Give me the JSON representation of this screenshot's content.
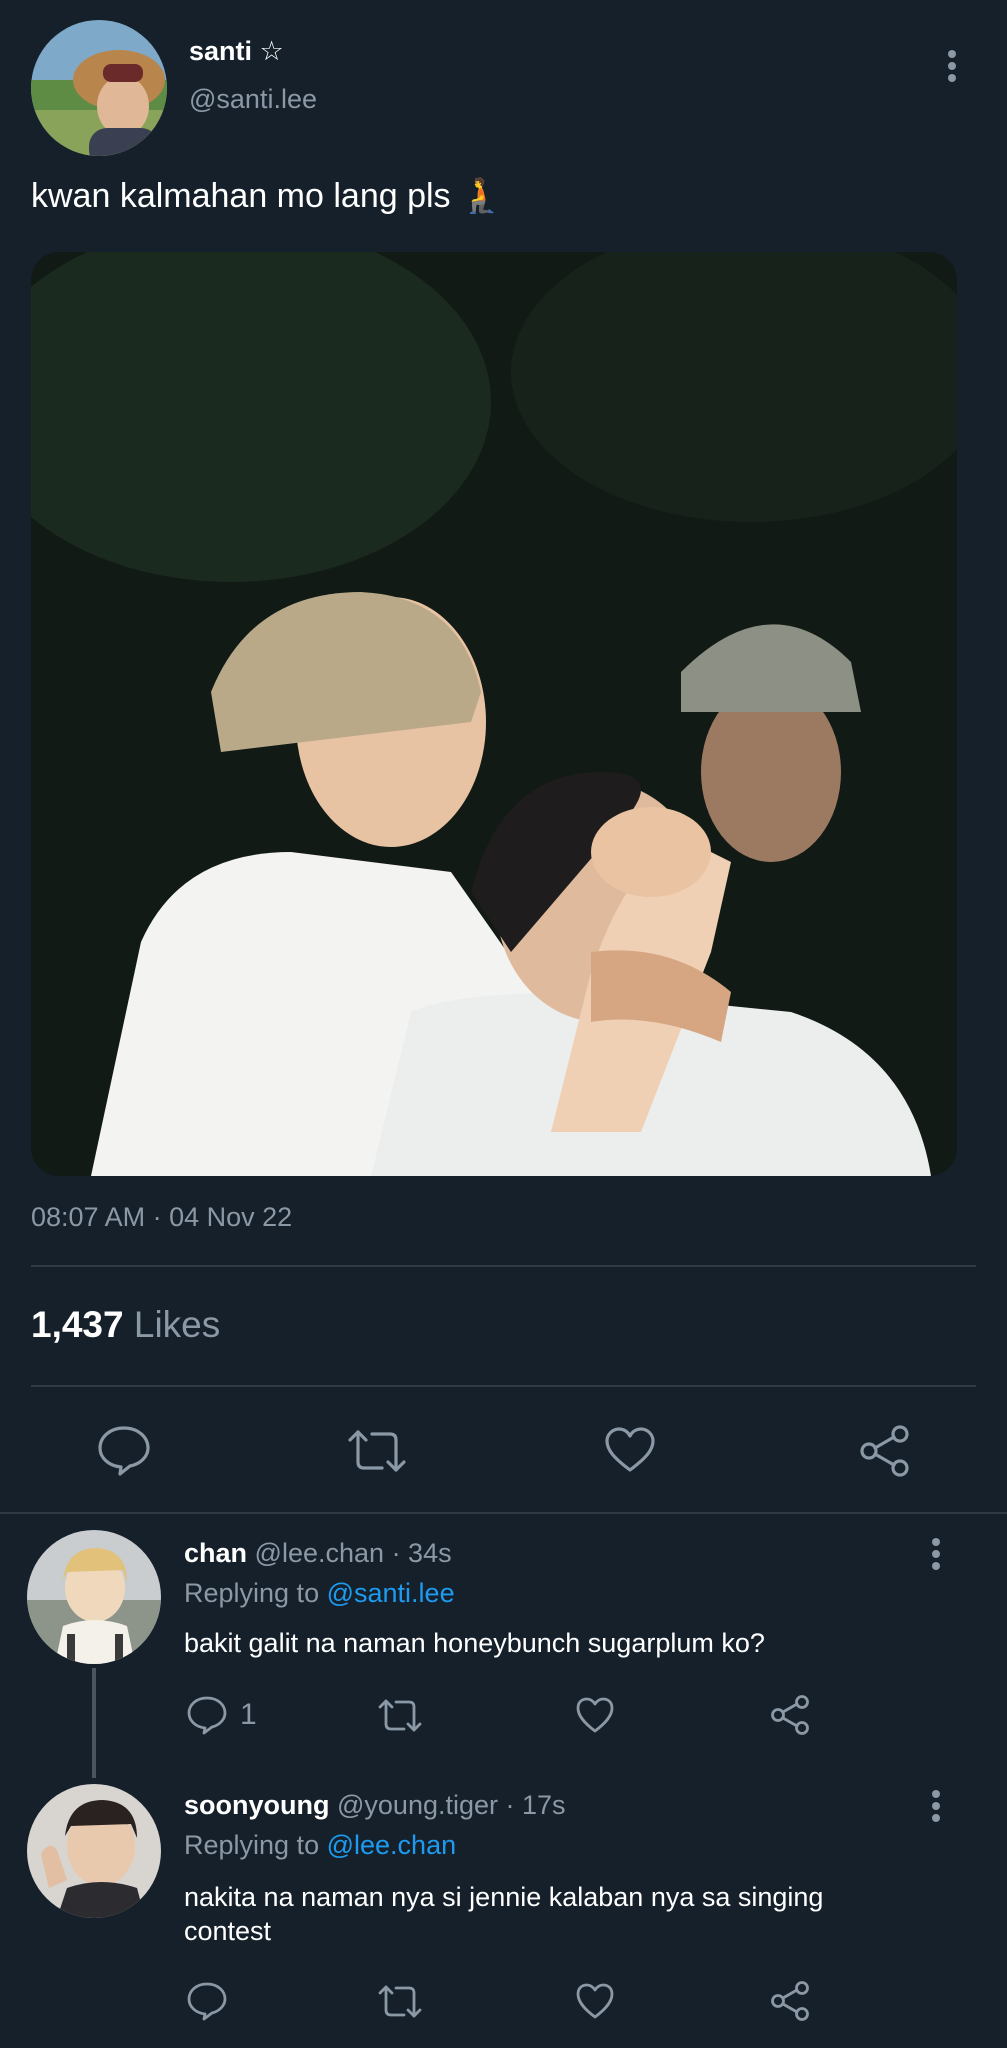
{
  "tweet": {
    "author": {
      "name": "santi",
      "verified_glyph": "☆",
      "handle": "@santi.lee"
    },
    "text": "kwan kalmahan mo lang pls 🧎",
    "timestamp": "08:07 AM · 04 Nov 22",
    "likes_count": "1,437",
    "likes_label": "Likes",
    "actions": {
      "reply": "reply-icon",
      "retweet": "retweet-icon",
      "like": "heart-icon",
      "share": "share-icon"
    }
  },
  "replies": [
    {
      "name": "chan",
      "handle": "@lee.chan",
      "time": "· 34s",
      "replying_prefix": "Replying to",
      "replying_to": "@santi.lee",
      "text": "bakit galit na naman honeybunch sugarplum ko?",
      "reply_count": "1"
    },
    {
      "name": "soonyoung",
      "handle": "@young.tiger",
      "time": "· 17s",
      "replying_prefix": "Replying to",
      "replying_to": "@lee.chan",
      "text": "nakita na naman nya si jennie kalaban nya sa singing contest",
      "reply_count": ""
    }
  ],
  "colors": {
    "background": "#15202b",
    "muted": "#8b98a5",
    "link": "#1d9bf0",
    "divider": "#2f3a45"
  }
}
